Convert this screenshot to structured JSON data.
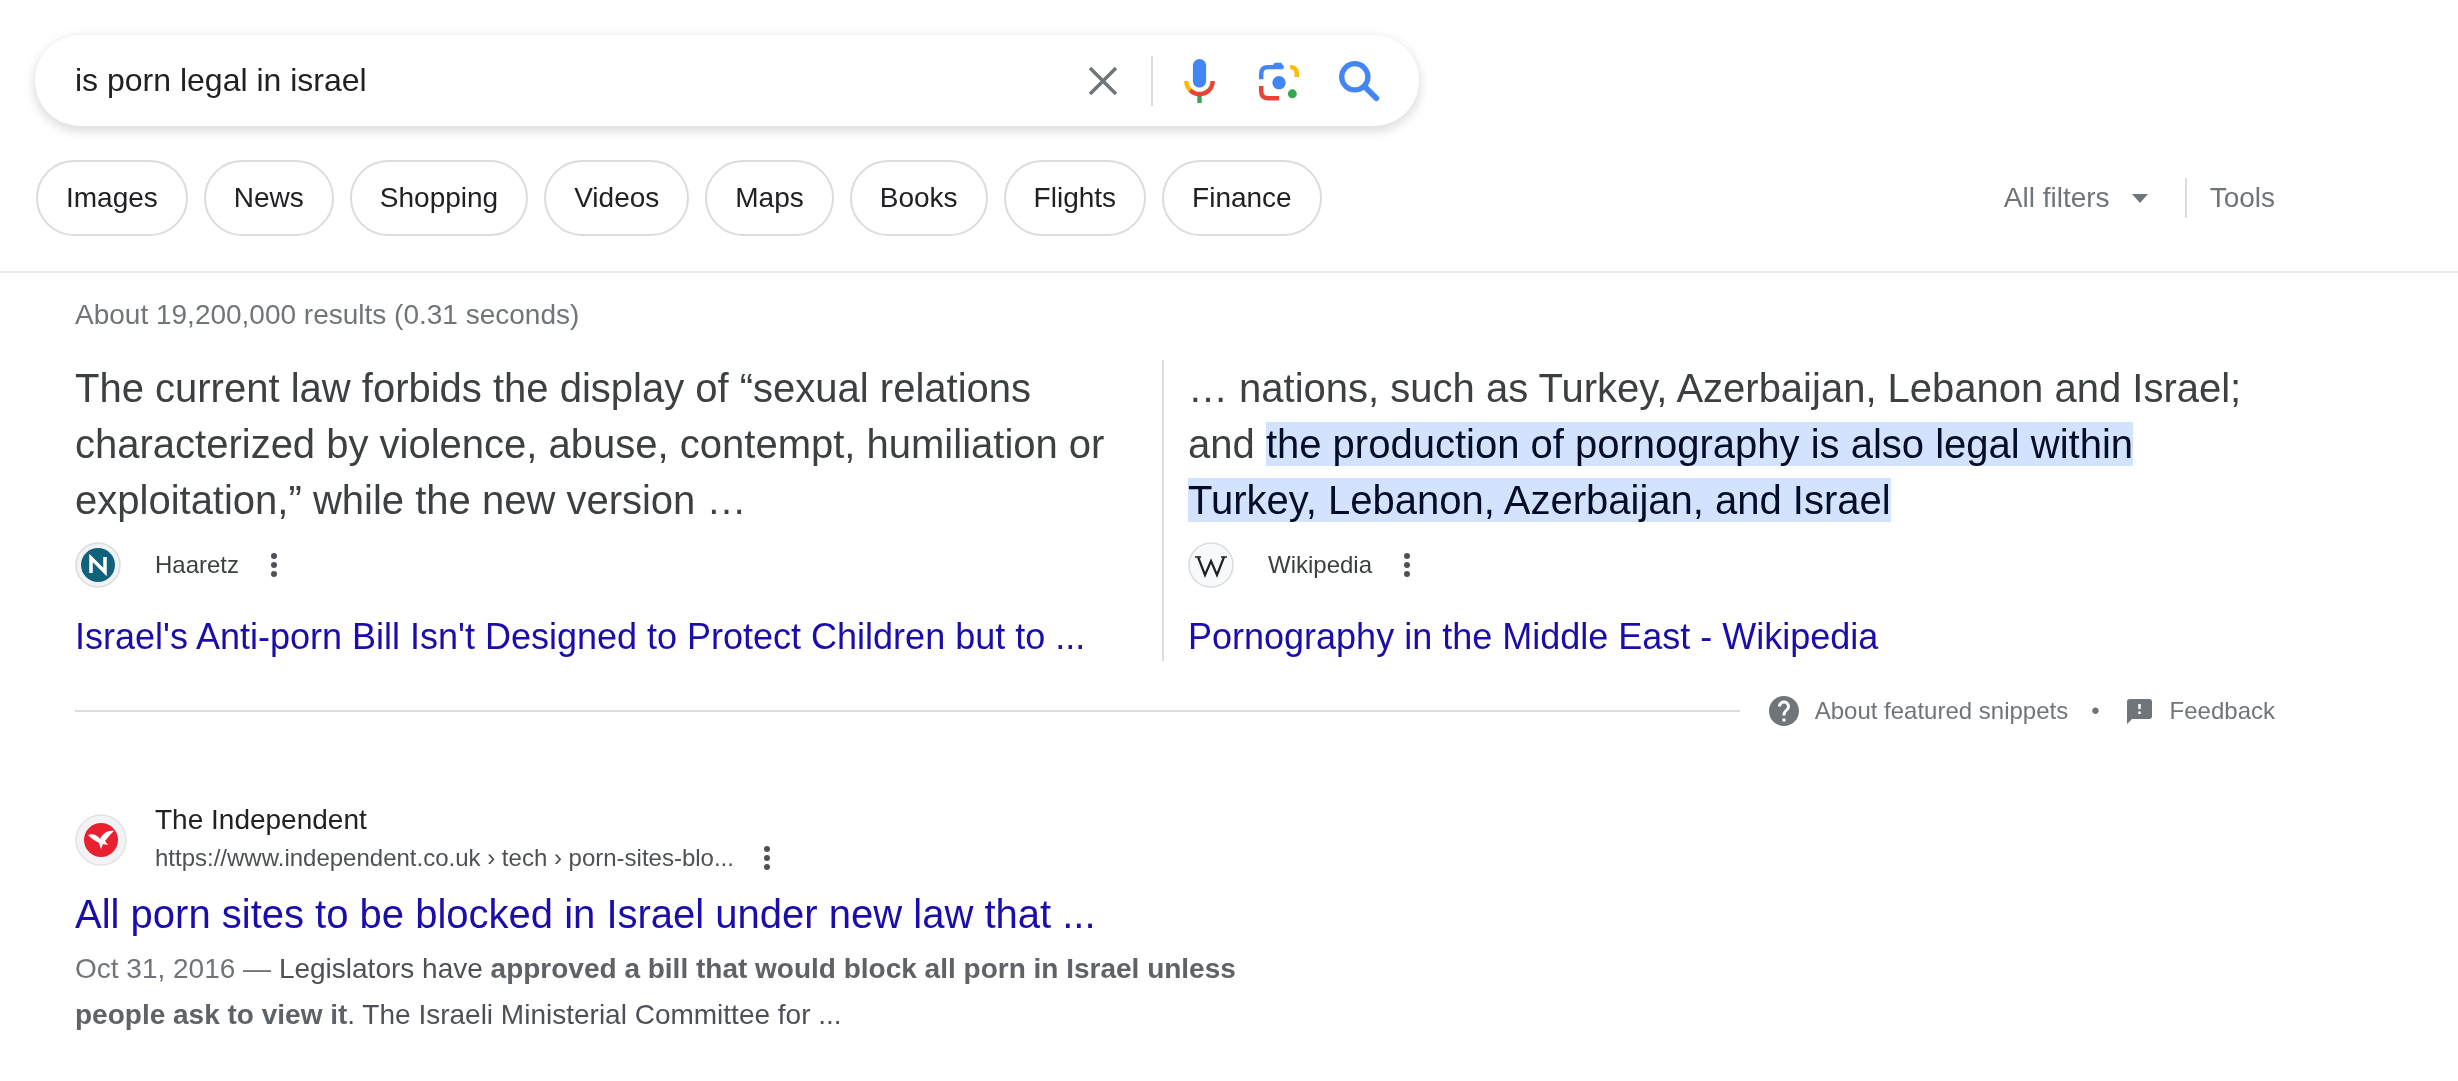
{
  "search": {
    "query": "is porn legal in israel"
  },
  "chips": [
    "Images",
    "News",
    "Shopping",
    "Videos",
    "Maps",
    "Books",
    "Flights",
    "Finance"
  ],
  "filters": {
    "all_filters": "All filters",
    "tools": "Tools"
  },
  "result_stats": "About 19,200,000 results (0.31 seconds)",
  "featured_snippets": {
    "items": [
      {
        "segments": [
          {
            "text": "The current law forbids the display of “sexual relations characterized by violence, abuse, contempt, humiliation or exploitation,” while the new version …",
            "highlighted": false
          }
        ],
        "source": "Haaretz",
        "link": "Israel's Anti-porn Bill Isn't Designed to Protect Children but to ..."
      },
      {
        "segments": [
          {
            "text": "… nations, such as Turkey, Azerbaijan, Lebanon and Israel; and",
            "highlighted": false
          },
          {
            "text": "the production of pornography is also legal within Turkey, Lebanon, Azerbaijan, and Israel",
            "highlighted": true
          }
        ],
        "source": "Wikipedia",
        "link": "Pornography in the Middle East - Wikipedia"
      }
    ],
    "about": "About featured snippets",
    "separator": "•",
    "feedback": "Feedback"
  },
  "results": [
    {
      "source": "The Independent",
      "url": "https://www.independent.co.uk › tech › porn-sites-blo...",
      "title": "All porn sites to be blocked in Israel under new law that ...",
      "date": "Oct 31, 2016 —",
      "snippet": "Legislators have **approved a bill that would block all porn in Israel unless people ask to view it**. The Israeli Ministerial Committee for ..."
    }
  ]
}
